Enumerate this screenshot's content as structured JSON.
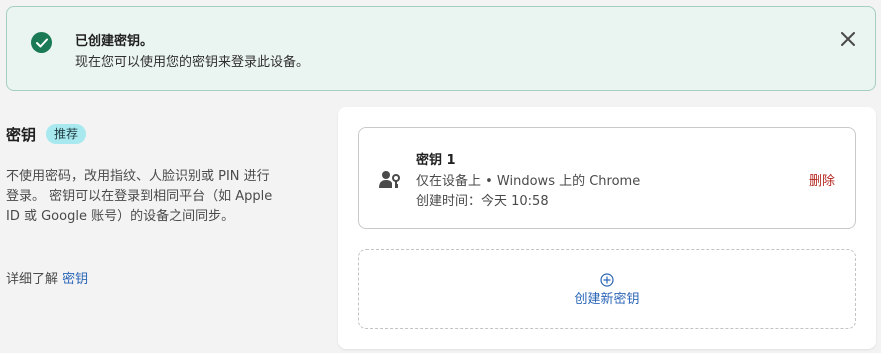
{
  "banner": {
    "title": "已创建密钥。",
    "message": "现在您可以使用您的密钥来登录此设备。",
    "icon": "check-circle-icon",
    "close_icon": "close-icon"
  },
  "section": {
    "title": "密钥",
    "badge": "推荐",
    "description": "不使用密码，改用指纹、人脸识别或 PIN 进行登录。 密钥可以在登录到相同平台（如 Apple ID 或 Google 账号）的设备之间同步。",
    "learn_more_prefix": "详细了解",
    "learn_more_link": "密钥"
  },
  "keys": [
    {
      "name": "密钥 1",
      "location": "仅在设备上 • Windows 上的 Chrome",
      "created": "创建时间：今天 10:58",
      "delete_label": "删除",
      "icon": "user-key-icon"
    }
  ],
  "create": {
    "label": "创建新密钥",
    "icon": "plus-circle-icon"
  },
  "colors": {
    "success": "#1a7a55",
    "banner_bg": "#eaf4f1",
    "badge_bg": "#a8e9f0",
    "link": "#2b66b7",
    "danger": "#b3261e"
  }
}
